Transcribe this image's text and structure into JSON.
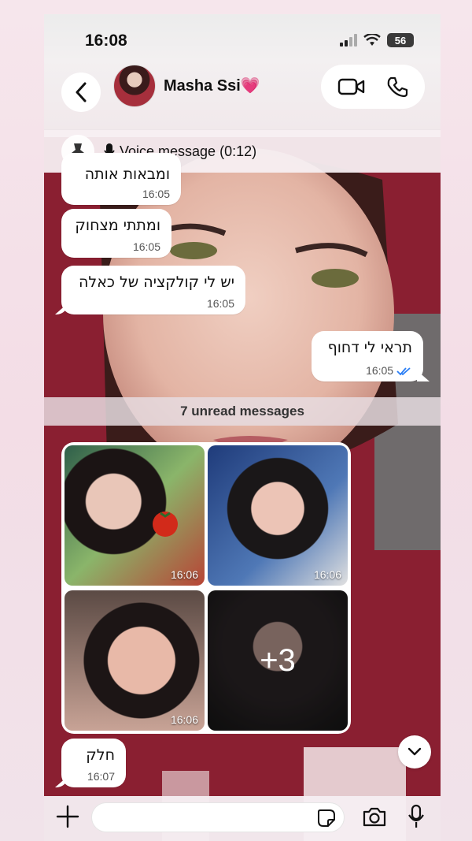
{
  "status_bar": {
    "time": "16:08",
    "battery": "56"
  },
  "header": {
    "back_icon": "chevron-left-icon",
    "contact_name": "Masha Ssi💗",
    "video_call_icon": "video-camera-icon",
    "voice_call_icon": "phone-icon"
  },
  "pinned": {
    "pin_icon": "pin-icon",
    "mic_icon": "mic-icon",
    "text": "Voice message (0:12)"
  },
  "messages": [
    {
      "text": "ומבאות אותה",
      "time": "16:05",
      "direction": "incoming"
    },
    {
      "text": "ומתתי מצחוק",
      "time": "16:05",
      "direction": "incoming"
    },
    {
      "text": "יש לי קולקציה של כאלה",
      "time": "16:05",
      "direction": "incoming"
    },
    {
      "text": "תראי לי דחוף",
      "time": "16:05",
      "direction": "outgoing",
      "read": true
    }
  ],
  "unread_label": "7 unread messages",
  "album": {
    "photos": [
      {
        "time": "16:06"
      },
      {
        "time": "16:06"
      },
      {
        "time": "16:06"
      },
      {
        "more": "+3"
      }
    ]
  },
  "last_message": {
    "text": "חלק",
    "time": "16:07",
    "direction": "incoming"
  },
  "colors": {
    "read_check": "#2a7ef5",
    "bubble": "#ffffff",
    "hoodie": "#8a1f31"
  },
  "input_bar": {
    "attach_icon": "plus-icon",
    "sticker_icon": "sticker-icon",
    "camera_icon": "camera-icon",
    "mic_icon": "mic-icon",
    "placeholder": ""
  },
  "scroll_icon": "chevron-down-icon"
}
